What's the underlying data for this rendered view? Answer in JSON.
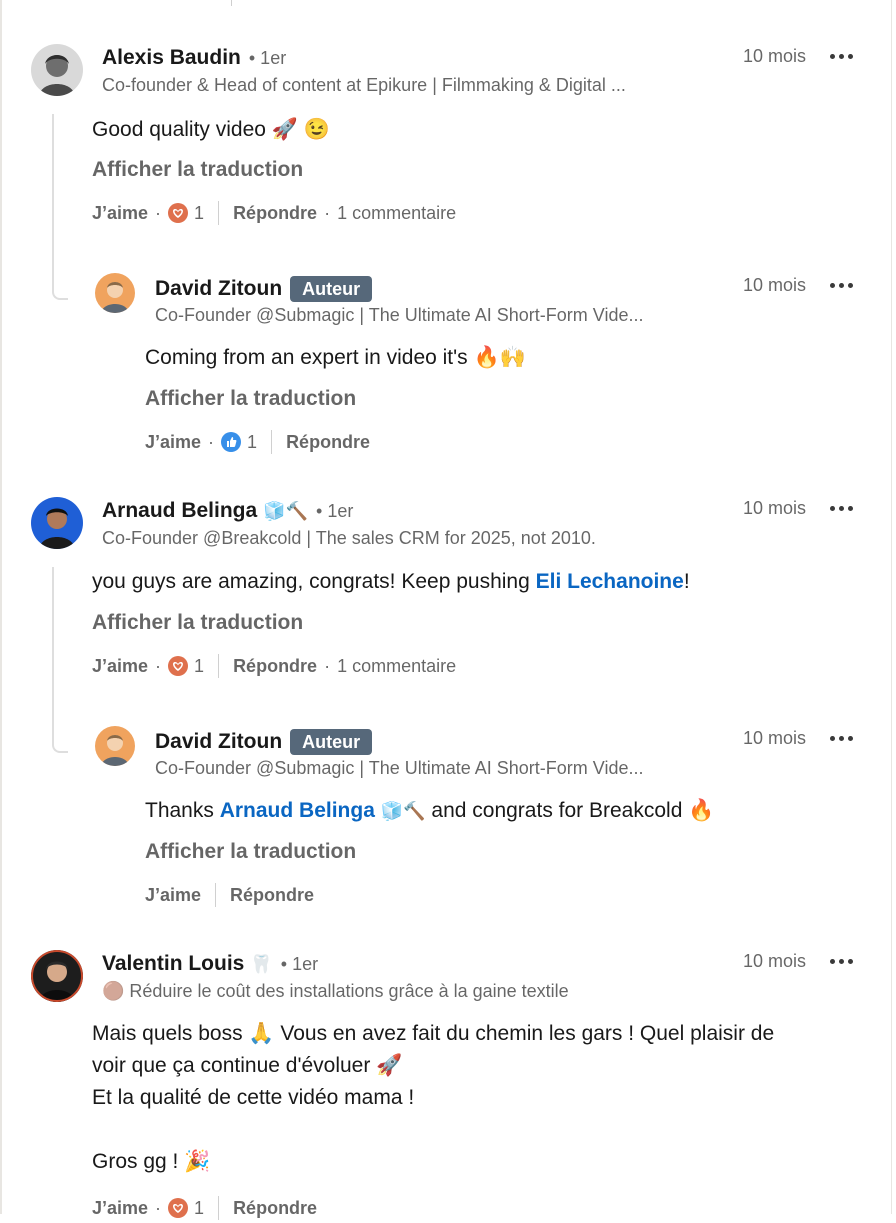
{
  "comments": [
    {
      "author": "Alexis Baudin",
      "degree": "• 1er",
      "headline": "Co-founder & Head of content at Epikure | Filmmaking & Digital ...",
      "time": "10 mois",
      "text": "Good quality video 🚀 😉",
      "translate": "Afficher la traduction",
      "like_label": "J’aime",
      "reaction_count": "1",
      "reply_label": "Répondre",
      "reply_count": "1 commentaire",
      "replies": [
        {
          "author": "David Zitoun",
          "badge": "Auteur",
          "headline": "Co-Founder @Submagic | The Ultimate AI Short-Form Vide...",
          "time": "10 mois",
          "text": "Coming from an expert in video it's 🔥🙌",
          "translate": "Afficher la traduction",
          "like_label": "J’aime",
          "reaction_count": "1",
          "reply_label": "Répondre"
        }
      ]
    },
    {
      "author": "Arnaud Belinga",
      "author_emoji": "🧊🔨",
      "degree": "• 1er",
      "headline": "Co-Founder @Breakcold | The sales CRM for 2025, not 2010.",
      "time": "10 mois",
      "text_before": "you guys are amazing, congrats! Keep pushing ",
      "mention": "Eli Lechanoine",
      "text_after": "!",
      "translate": "Afficher la traduction",
      "like_label": "J’aime",
      "reaction_count": "1",
      "reply_label": "Répondre",
      "reply_count": "1 commentaire",
      "replies": [
        {
          "author": "David Zitoun",
          "badge": "Auteur",
          "headline": "Co-Founder @Submagic | The Ultimate AI Short-Form Vide...",
          "time": "10 mois",
          "text_before": "Thanks ",
          "mention": "Arnaud Belinga",
          "mention_emoji": "🧊🔨",
          "text_after": " and congrats for Breakcold 🔥",
          "translate": "Afficher la traduction",
          "like_label": "J’aime",
          "reply_label": "Répondre"
        }
      ]
    },
    {
      "author": "Valentin Louis",
      "author_emoji": "🦷",
      "degree": "• 1er",
      "headline": "🟤 Réduire le coût des installations grâce à la gaine textile",
      "time": "10 mois",
      "text_lines": [
        "Mais quels boss 🙏 Vous en avez fait du chemin les gars ! Quel plaisir de",
        "voir que ça continue d'évoluer 🚀",
        "Et la qualité de cette vidéo mama !",
        "",
        "Gros gg ! 🎉"
      ],
      "like_label": "J’aime",
      "reaction_count": "1",
      "reply_label": "Répondre"
    }
  ],
  "reaction_icons": {
    "love": "heart-reaction-icon",
    "like": "thumbs-up-reaction-icon"
  },
  "colors": {
    "mention": "#0a66c2",
    "badge_bg": "#56687a",
    "love_reaction": "#df704d",
    "like_reaction": "#378fe9"
  }
}
